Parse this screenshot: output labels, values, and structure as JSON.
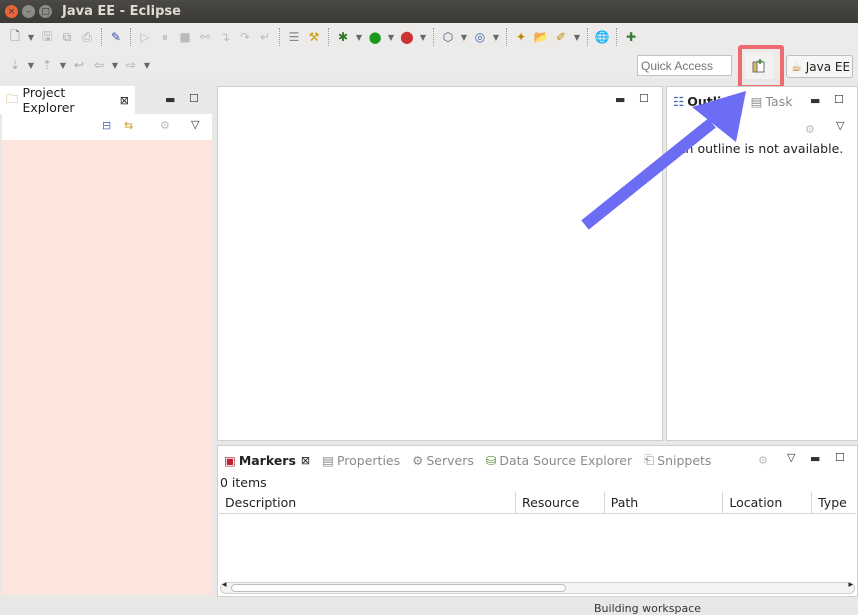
{
  "window": {
    "title": "Java EE - Eclipse",
    "close": "×",
    "min": "–",
    "max": "□"
  },
  "toolbar1": {
    "icons": [
      "new-wizard-icon",
      "save-icon",
      "save-all-icon",
      "print-icon",
      "toggle-breadcrumb-icon",
      "resume-icon",
      "suspend-icon",
      "terminate-icon",
      "disconnect-icon",
      "step-into-icon",
      "step-over-icon",
      "step-return-icon",
      "toggle-markers-icon",
      "drop-to-frame-icon",
      "debug-icon",
      "run-icon",
      "run-server-icon",
      "new-server-icon",
      "new-web-project-icon",
      "open-type-icon",
      "open-task-icon",
      "search-icon",
      "web-browser-icon",
      "pin-icon"
    ]
  },
  "toolbar2": {
    "quick_access_placeholder": "Quick Access",
    "perspective_label": "Java EE"
  },
  "project_explorer": {
    "title": "Project Explorer",
    "close_glyph": "⊠"
  },
  "outline": {
    "tab1": "Outline",
    "tab2": "Task",
    "message": "An outline is not available."
  },
  "bottom": {
    "tabs": [
      "Markers",
      "Properties",
      "Servers",
      "Data Source Explorer",
      "Snippets"
    ],
    "items_count": "0 items",
    "columns": [
      "Description",
      "Resource",
      "Path",
      "Location",
      "Type"
    ]
  },
  "status": {
    "text": "Building workspace"
  },
  "colors": {
    "highlight": "#f06a72",
    "arrow": "#6c6cf5",
    "explorer_bg": "#fde4dd"
  }
}
